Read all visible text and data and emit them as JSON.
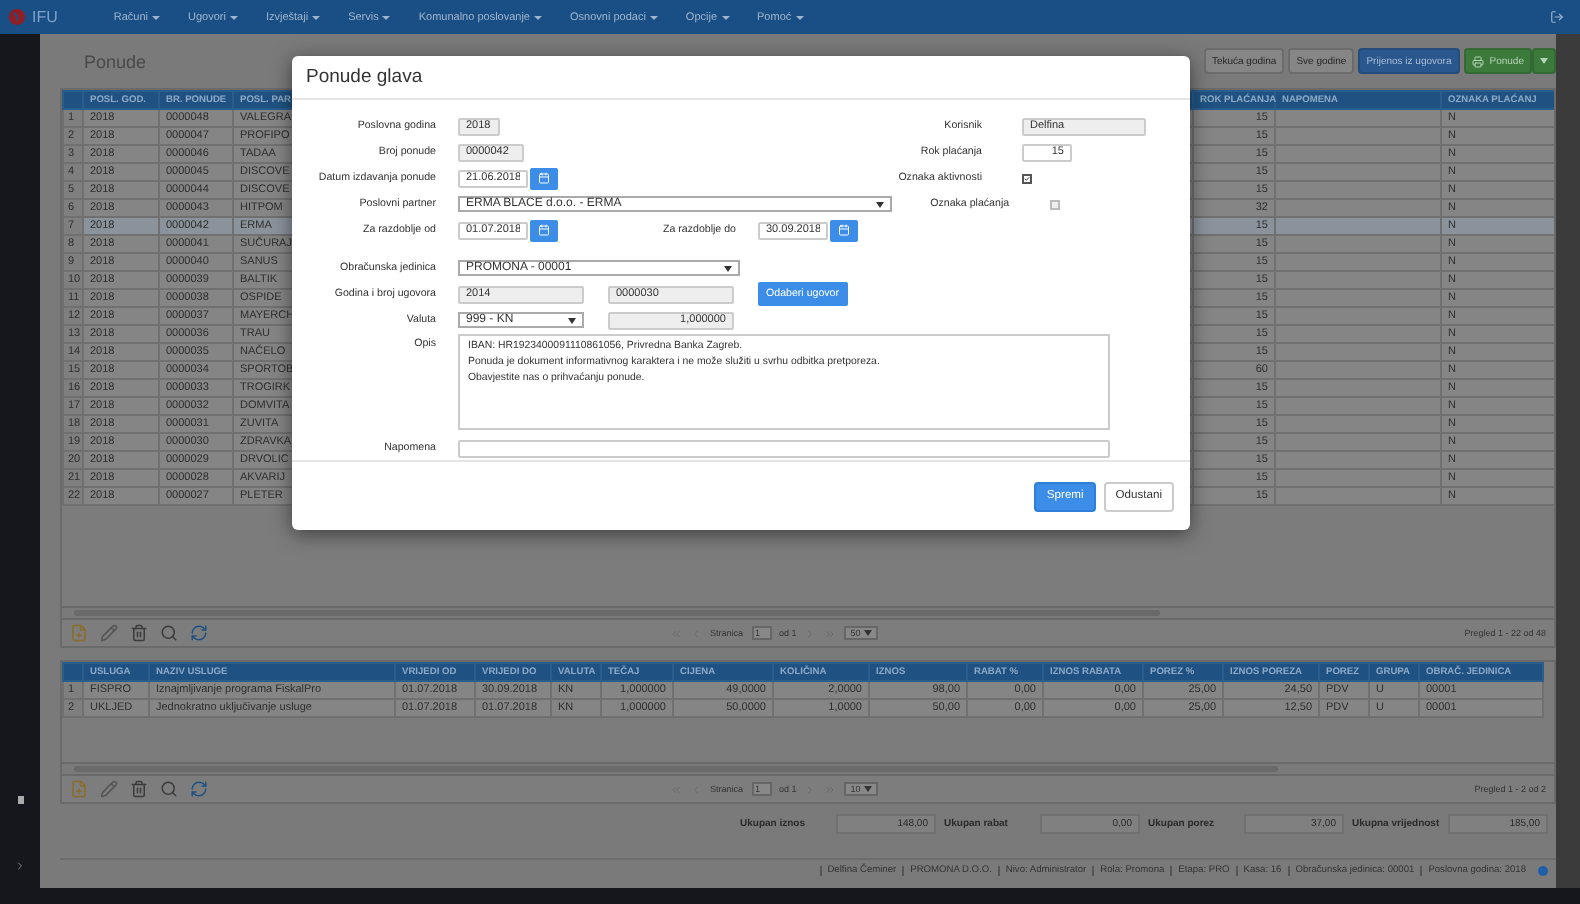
{
  "app": {
    "logo": "IFU",
    "menu": [
      "Računi",
      "Ugovori",
      "Izvještaji",
      "Servis",
      "Komunalno poslovanje",
      "Osnovni podaci",
      "Opcije",
      "Pomoć"
    ]
  },
  "page": {
    "title": "Ponude",
    "buttons": [
      {
        "label": "Tekuća godina",
        "kind": "default"
      },
      {
        "label": "Sve godine",
        "kind": "default"
      },
      {
        "label": "Prijenos iz ugovora",
        "kind": "primary"
      },
      {
        "label": "Ponude",
        "kind": "print_menu"
      }
    ]
  },
  "offers": {
    "columns": [
      "POSL. GOD.",
      "BR. PONUDE",
      "POSL. PAR",
      "ROK PLAĆANJA",
      "NAPOMENA",
      "OZNAKA PLAĆANJ"
    ],
    "rows": [
      {
        "n": "1",
        "year": "2018",
        "number": "0000048",
        "partner": "VALEGRA",
        "payment_term": "15",
        "payment_flag": "N",
        "selected": false
      },
      {
        "n": "2",
        "year": "2018",
        "number": "0000047",
        "partner": "PROFIPO",
        "payment_term": "15",
        "payment_flag": "N",
        "selected": false
      },
      {
        "n": "3",
        "year": "2018",
        "number": "0000046",
        "partner": "TADAA",
        "payment_term": "15",
        "payment_flag": "N",
        "selected": false
      },
      {
        "n": "4",
        "year": "2018",
        "number": "0000045",
        "partner": "DISCOVE",
        "payment_term": "15",
        "payment_flag": "N",
        "selected": false
      },
      {
        "n": "5",
        "year": "2018",
        "number": "0000044",
        "partner": "DISCOVE",
        "payment_term": "15",
        "payment_flag": "N",
        "selected": false
      },
      {
        "n": "6",
        "year": "2018",
        "number": "0000043",
        "partner": "HITPOM",
        "payment_term": "32",
        "payment_flag": "N",
        "selected": false
      },
      {
        "n": "7",
        "year": "2018",
        "number": "0000042",
        "partner": "ERMA",
        "payment_term": "15",
        "payment_flag": "N",
        "selected": true
      },
      {
        "n": "8",
        "year": "2018",
        "number": "0000041",
        "partner": "SUČURAJ",
        "payment_term": "15",
        "payment_flag": "N",
        "selected": false
      },
      {
        "n": "9",
        "year": "2018",
        "number": "0000040",
        "partner": "SANUS",
        "payment_term": "15",
        "payment_flag": "N",
        "selected": false
      },
      {
        "n": "10",
        "year": "2018",
        "number": "0000039",
        "partner": "BALTIK",
        "payment_term": "15",
        "payment_flag": "N",
        "selected": false
      },
      {
        "n": "11",
        "year": "2018",
        "number": "0000038",
        "partner": "OSPIDE",
        "payment_term": "15",
        "payment_flag": "N",
        "selected": false
      },
      {
        "n": "12",
        "year": "2018",
        "number": "0000037",
        "partner": "MAYERCH",
        "payment_term": "15",
        "payment_flag": "N",
        "selected": false
      },
      {
        "n": "13",
        "year": "2018",
        "number": "0000036",
        "partner": "TRAU",
        "payment_term": "15",
        "payment_flag": "N",
        "selected": false
      },
      {
        "n": "14",
        "year": "2018",
        "number": "0000035",
        "partner": "NAČELO",
        "payment_term": "15",
        "payment_flag": "N",
        "selected": false
      },
      {
        "n": "15",
        "year": "2018",
        "number": "0000034",
        "partner": "SPORTOB",
        "payment_term": "60",
        "payment_flag": "N",
        "selected": false
      },
      {
        "n": "16",
        "year": "2018",
        "number": "0000033",
        "partner": "TROGIRK",
        "payment_term": "15",
        "payment_flag": "N",
        "selected": false
      },
      {
        "n": "17",
        "year": "2018",
        "number": "0000032",
        "partner": "DOMVITA",
        "payment_term": "15",
        "payment_flag": "N",
        "selected": false
      },
      {
        "n": "18",
        "year": "2018",
        "number": "0000031",
        "partner": "ZUVITA",
        "payment_term": "15",
        "payment_flag": "N",
        "selected": false
      },
      {
        "n": "19",
        "year": "2018",
        "number": "0000030",
        "partner": "ZDRAVKA",
        "payment_term": "15",
        "payment_flag": "N",
        "selected": false
      },
      {
        "n": "20",
        "year": "2018",
        "number": "0000029",
        "partner": "DRVOLIC",
        "payment_term": "15",
        "payment_flag": "N",
        "selected": false
      },
      {
        "n": "21",
        "year": "2018",
        "number": "0000028",
        "partner": "AKVARIJ",
        "payment_term": "15",
        "payment_flag": "N",
        "selected": false
      },
      {
        "n": "22",
        "year": "2018",
        "number": "0000027",
        "partner": "PLETER",
        "payment_term": "15",
        "payment_flag": "N",
        "selected": false
      }
    ],
    "pager": {
      "page_label": "Stranica",
      "page": "1",
      "of": "od 1",
      "page_size": "50",
      "summary": "Pregled 1 - 22 od 48"
    }
  },
  "items": {
    "columns": [
      "USLUGA",
      "NAZIV USLUGE",
      "VRIJEDI OD",
      "VRIJEDI DO",
      "VALUTA",
      "TEČAJ",
      "CIJENA",
      "KOLIČINA",
      "IZNOS",
      "RABAT %",
      "IZNOS RABATA",
      "POREZ %",
      "IZNOS POREZA",
      "POREZ",
      "GRUPA",
      "OBRAČ. JEDINICA"
    ],
    "rows": [
      {
        "n": "1",
        "cells": [
          "FISPRO",
          "Iznajmljivanje programa FiskalPro",
          "01.07.2018",
          "30.09.2018",
          "KN",
          "1,000000",
          "49,0000",
          "2,0000",
          "98,00",
          "0,00",
          "0,00",
          "25,00",
          "24,50",
          "PDV",
          "U",
          "00001"
        ]
      },
      {
        "n": "2",
        "cells": [
          "UKLJED",
          "Jednokratno uključivanje usluge",
          "01.07.2018",
          "01.07.2018",
          "KN",
          "1,000000",
          "50,0000",
          "1,0000",
          "50,00",
          "0,00",
          "0,00",
          "25,00",
          "12,50",
          "PDV",
          "U",
          "00001"
        ]
      }
    ],
    "pager": {
      "page_label": "Stranica",
      "page": "1",
      "of": "od 1",
      "page_size": "10",
      "summary": "Pregled 1 - 2 od 2"
    }
  },
  "totals": [
    {
      "label": "Ukupan iznos",
      "value": "148,00"
    },
    {
      "label": "Ukupan rabat",
      "value": "0,00"
    },
    {
      "label": "Ukupan porez",
      "value": "37,00"
    },
    {
      "label": "Ukupna vrijednost",
      "value": "185,00"
    }
  ],
  "status_bar": [
    "Delfina Čeminer",
    "PROMONA D.O.O.",
    "Nivo: Administrator",
    "Rola: Promona",
    "Etapa: PRO",
    "Kasa: 16",
    "Obračunska jedinica: 00001",
    "Poslovna godina: 2018"
  ],
  "dialog": {
    "title": "Ponude glava",
    "year": {
      "label": "Poslovna godina",
      "value": "2018"
    },
    "offer_number": {
      "label": "Broj ponude",
      "value": "0000042"
    },
    "issue_date": {
      "label": "Datum izdavanja ponude",
      "value": "21.06.2018"
    },
    "partner": {
      "label": "Poslovni partner",
      "value": "ERMA BLACE d.o.o. - ERMA"
    },
    "period_from": {
      "label": "Za razdoblje od",
      "value": "01.07.2018"
    },
    "period_to": {
      "label": "Za razdoblje do",
      "value": "30.09.2018"
    },
    "accounting_unit": {
      "label": "Obračunska jedinica",
      "value": "PROMONA - 00001"
    },
    "contract": {
      "label": "Godina i broj ugovora",
      "year": "2014",
      "number": "0000030",
      "button": "Odaberi ugovor"
    },
    "currency": {
      "label": "Valuta",
      "value": "999 - KN",
      "rate": "1,000000"
    },
    "description": {
      "label": "Opis",
      "value": "IBAN: HR1923400091110861056, Privredna Banka Zagreb.\nPonuda je dokument informativnog karaktera i ne može služiti u svrhu odbitka pretporeza.\nObavjestite nas o prihvaćanju ponude."
    },
    "note": {
      "label": "Napomena"
    },
    "user": {
      "label": "Korisnik",
      "value": "Delfina"
    },
    "payment_term": {
      "label": "Rok plaćanja",
      "value": "15"
    },
    "activity_flag": {
      "label": "Oznaka aktivnosti",
      "checked": true
    },
    "payment_flag": {
      "label": "Oznaka plaćanja",
      "checked": false
    },
    "buttons": [
      {
        "label": "Spremi",
        "kind": "primary"
      },
      {
        "label": "Odustani",
        "kind": "default"
      }
    ]
  }
}
